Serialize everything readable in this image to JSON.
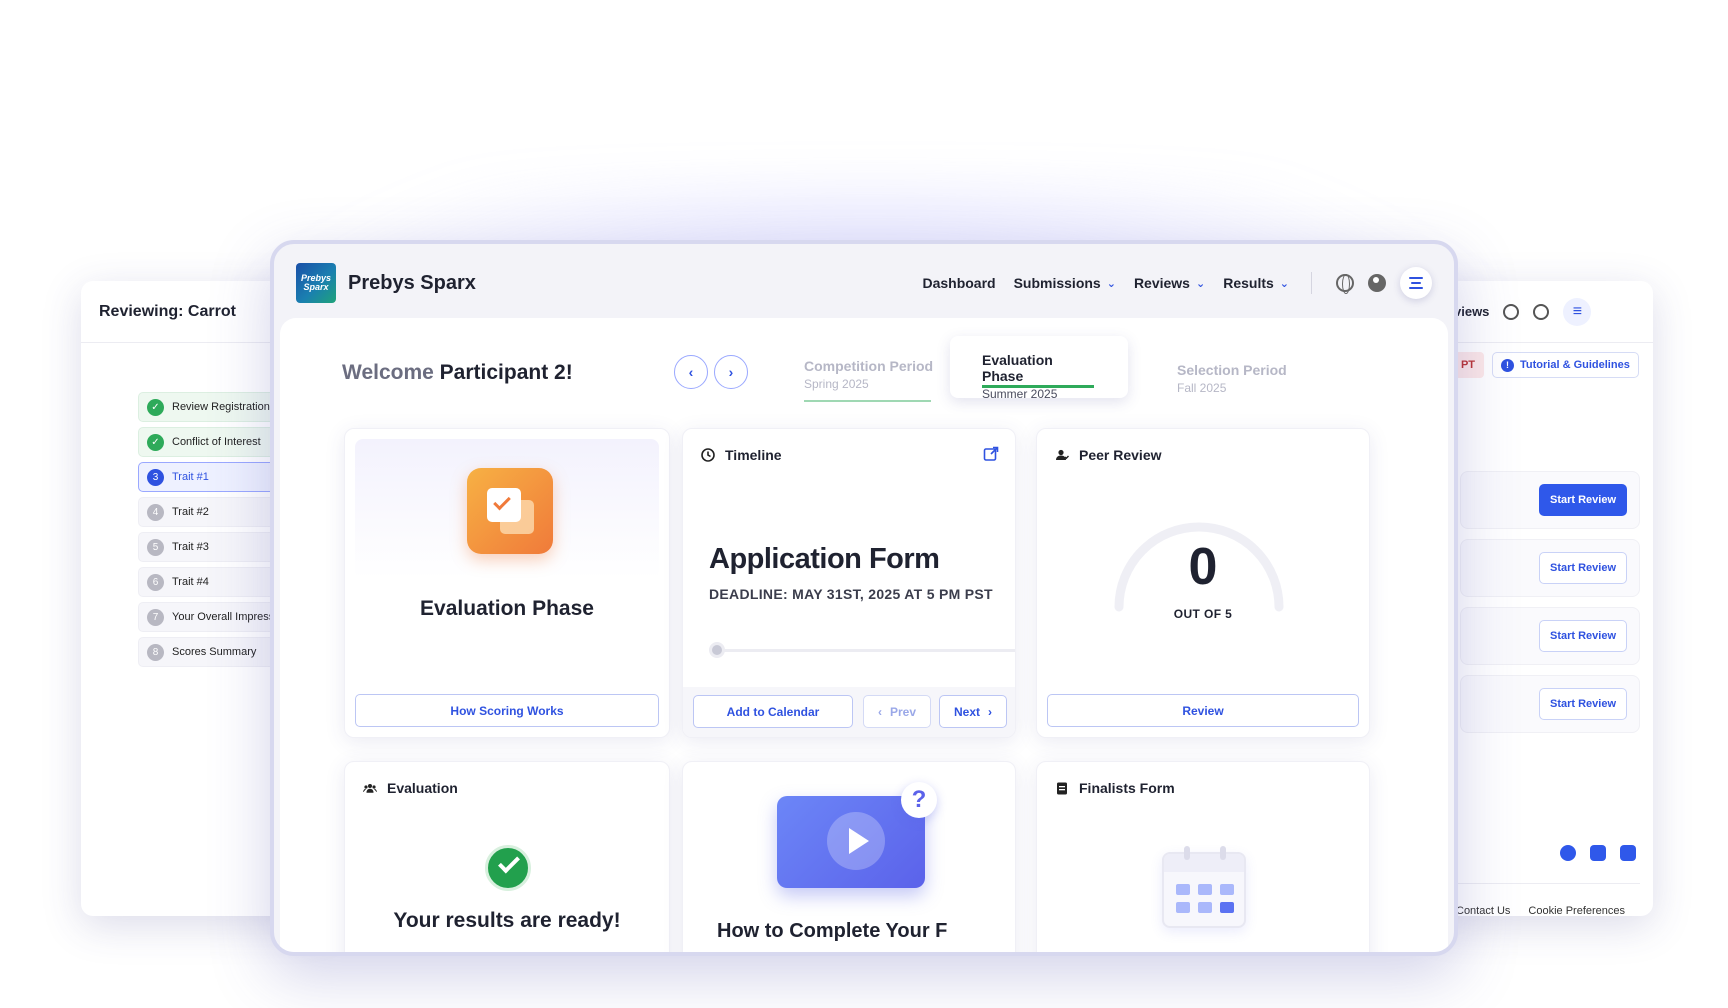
{
  "back_left": {
    "title": "Reviewing: Carrot",
    "steps": [
      {
        "num": "✓",
        "label": "Review Registration",
        "state": "done"
      },
      {
        "num": "✓",
        "label": "Conflict of Interest",
        "state": "done"
      },
      {
        "num": "3",
        "label": "Trait #1",
        "state": "active"
      },
      {
        "num": "4",
        "label": "Trait #2",
        "state": "todo"
      },
      {
        "num": "5",
        "label": "Trait #3",
        "state": "todo"
      },
      {
        "num": "6",
        "label": "Trait #4",
        "state": "todo"
      },
      {
        "num": "7",
        "label": "Your Overall Impression",
        "state": "todo"
      },
      {
        "num": "8",
        "label": "Scores Summary",
        "state": "todo"
      }
    ]
  },
  "back_right": {
    "nav_label": "views",
    "tag": "PT",
    "tutorial_label": "Tutorial & Guidelines",
    "start_review_label": "Start Review",
    "footer_links": [
      "Contact Us",
      "Cookie Preferences"
    ]
  },
  "header": {
    "logo_text": "Prebys Sparx",
    "brand": "Prebys Sparx",
    "nav": [
      {
        "label": "Dashboard",
        "has_menu": false
      },
      {
        "label": "Submissions",
        "has_menu": true
      },
      {
        "label": "Reviews",
        "has_menu": true
      },
      {
        "label": "Results",
        "has_menu": true
      }
    ]
  },
  "welcome": {
    "prefix": "Welcome",
    "name": "Participant 2!"
  },
  "periods": [
    {
      "title": "Competition Period",
      "subtitle": "Spring 2025",
      "state": "past"
    },
    {
      "title": "Evaluation Phase",
      "subtitle": "Summer 2025",
      "state": "current"
    },
    {
      "title": "Selection Period",
      "subtitle": "Fall 2025",
      "state": "future"
    }
  ],
  "cards": {
    "phase": {
      "title": "Evaluation Phase",
      "button": "How Scoring Works"
    },
    "timeline": {
      "header": "Timeline",
      "title": "Application Form",
      "deadline": "DEADLINE: MAY 31ST, 2025 AT 5 PM PST",
      "calendar_button": "Add to Calendar",
      "prev_button": "Prev",
      "next_button": "Next"
    },
    "peer_review": {
      "header": "Peer Review",
      "count": "0",
      "count_label": "OUT OF 5",
      "button": "Review",
      "progress": 0,
      "total": 5
    },
    "evaluation": {
      "header": "Evaluation",
      "message": "Your results are ready!"
    },
    "video": {
      "caption": "How to Complete Your F"
    },
    "finalists": {
      "header": "Finalists Form"
    }
  },
  "colors": {
    "accent": "#2f52e0",
    "success": "#2eaa5a",
    "orange": "#f08a3c"
  }
}
